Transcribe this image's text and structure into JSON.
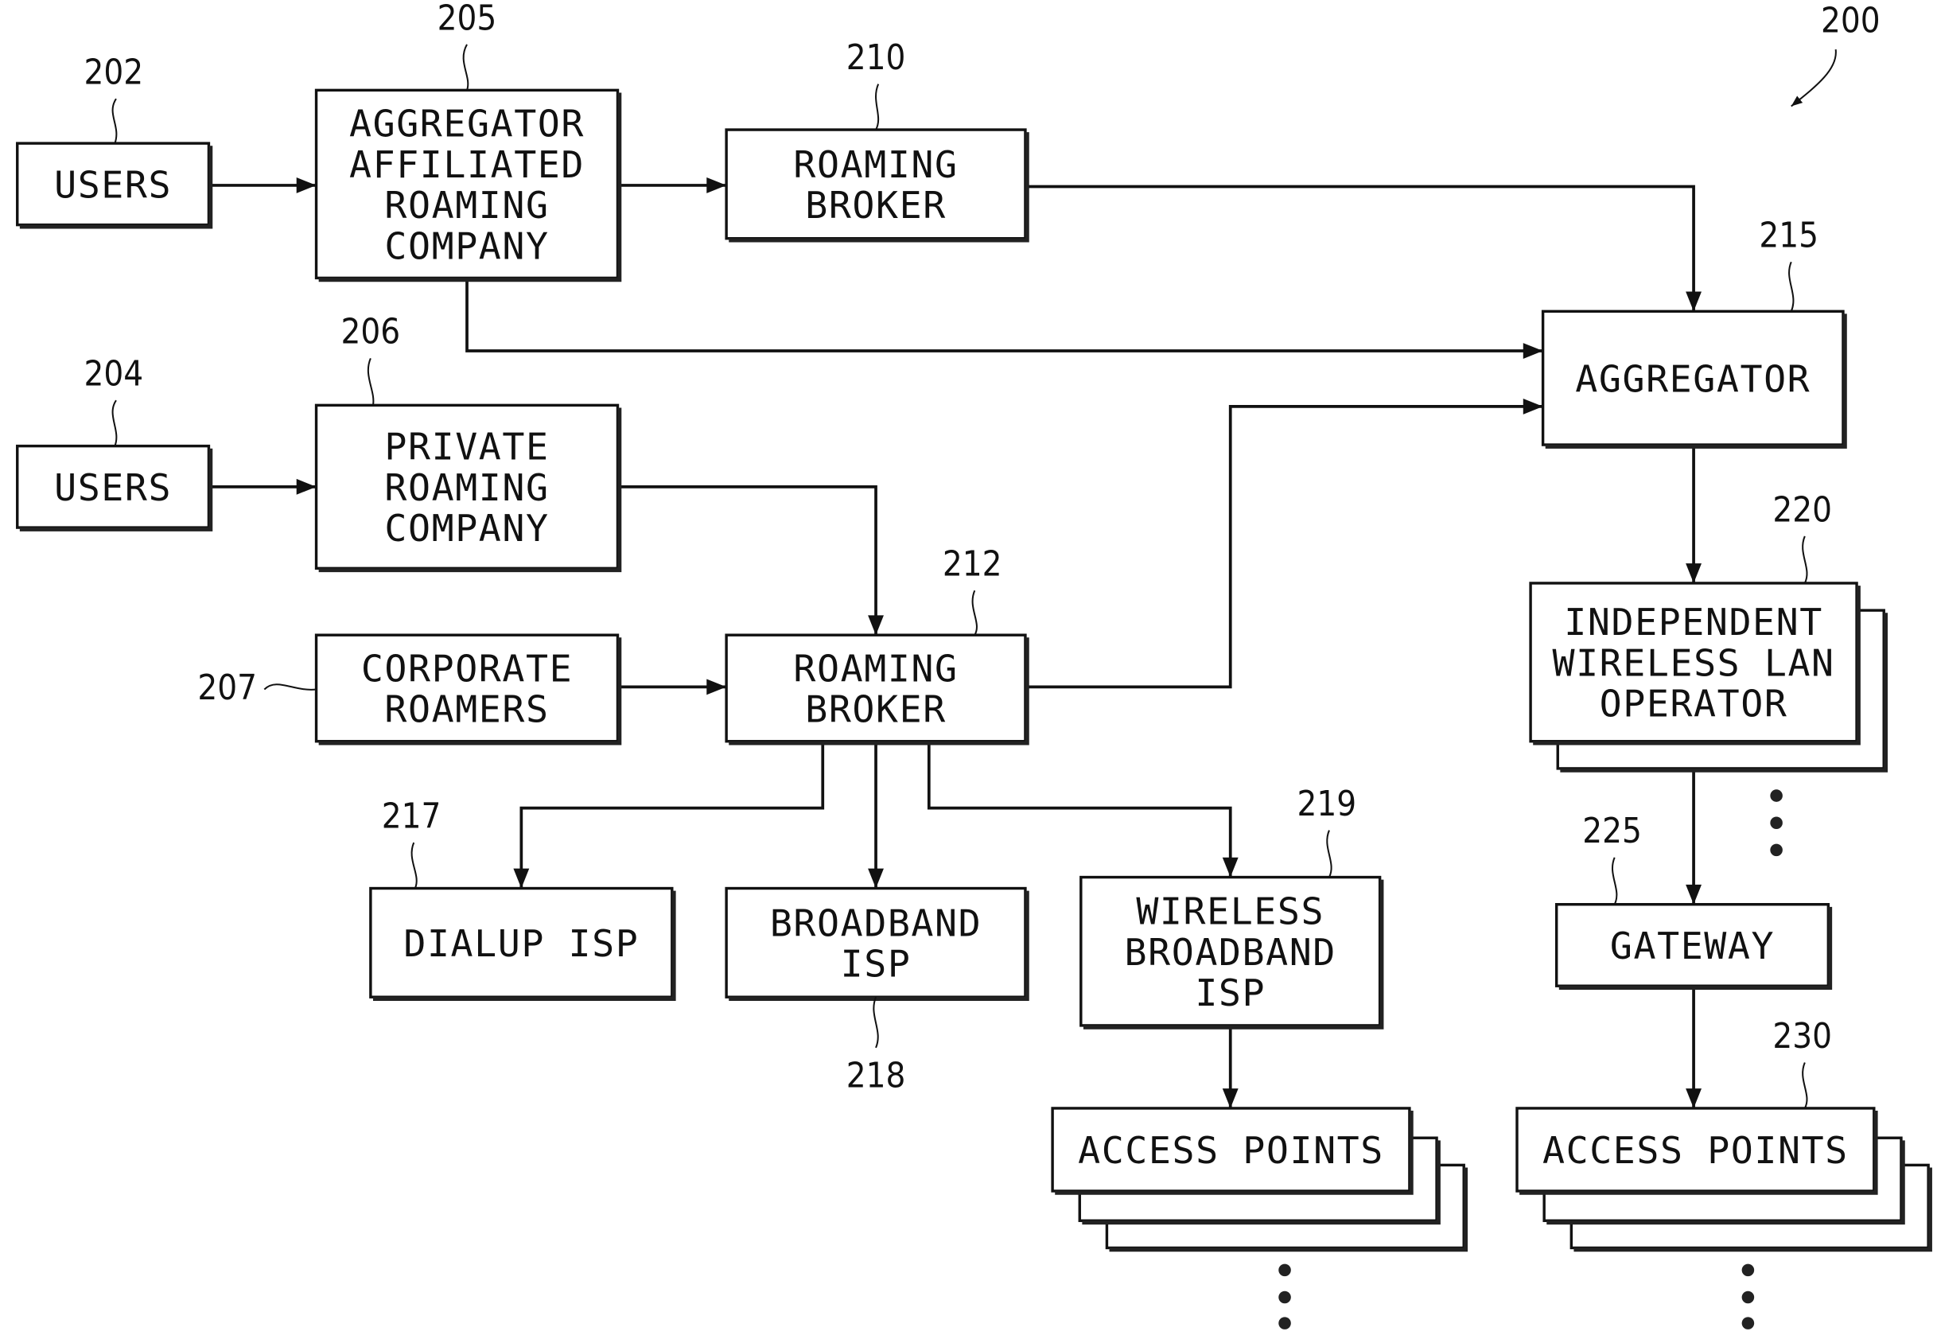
{
  "figure": {
    "title_ref": "200",
    "nodes": {
      "users_202": {
        "ref": "202",
        "lines": [
          "USERS"
        ]
      },
      "aggregator_affiliated_205": {
        "ref": "205",
        "lines": [
          "AGGREGATOR",
          "AFFILIATED",
          "ROAMING",
          "COMPANY"
        ]
      },
      "roaming_broker_210": {
        "ref": "210",
        "lines": [
          "ROAMING",
          "BROKER"
        ]
      },
      "users_204": {
        "ref": "204",
        "lines": [
          "USERS"
        ]
      },
      "private_roaming_206": {
        "ref": "206",
        "lines": [
          "PRIVATE",
          "ROAMING",
          "COMPANY"
        ]
      },
      "corporate_roamers_207": {
        "ref": "207",
        "lines": [
          "CORPORATE",
          "ROAMERS"
        ]
      },
      "roaming_broker_212": {
        "ref": "212",
        "lines": [
          "ROAMING",
          "BROKER"
        ]
      },
      "aggregator_215": {
        "ref": "215",
        "lines": [
          "AGGREGATOR"
        ]
      },
      "dialup_isp_217": {
        "ref": "217",
        "lines": [
          "DIALUP ISP"
        ]
      },
      "broadband_isp_218": {
        "ref": "218",
        "lines": [
          "BROADBAND",
          "ISP"
        ]
      },
      "wireless_broadband_isp_219": {
        "ref": "219",
        "lines": [
          "WIRELESS",
          "BROADBAND",
          "ISP"
        ]
      },
      "independent_wlan_operator_220": {
        "ref": "220",
        "lines": [
          "INDEPENDENT",
          "WIRELESS LAN",
          "OPERATOR"
        ]
      },
      "gateway_225": {
        "ref": "225",
        "lines": [
          "GATEWAY"
        ]
      },
      "access_points_230": {
        "ref": "230",
        "lines": [
          "ACCESS POINTS"
        ]
      },
      "access_points_219": {
        "ref": "",
        "lines": [
          "ACCESS POINTS"
        ]
      }
    },
    "edges": [
      [
        "users_202",
        "aggregator_affiliated_205"
      ],
      [
        "aggregator_affiliated_205",
        "roaming_broker_210"
      ],
      [
        "roaming_broker_210",
        "aggregator_215"
      ],
      [
        "aggregator_affiliated_205",
        "aggregator_215"
      ],
      [
        "users_204",
        "private_roaming_206"
      ],
      [
        "private_roaming_206",
        "roaming_broker_212"
      ],
      [
        "corporate_roamers_207",
        "roaming_broker_212"
      ],
      [
        "roaming_broker_212",
        "aggregator_215"
      ],
      [
        "roaming_broker_212",
        "dialup_isp_217"
      ],
      [
        "roaming_broker_212",
        "broadband_isp_218"
      ],
      [
        "roaming_broker_212",
        "wireless_broadband_isp_219"
      ],
      [
        "aggregator_215",
        "independent_wlan_operator_220"
      ],
      [
        "independent_wlan_operator_220",
        "gateway_225"
      ],
      [
        "gateway_225",
        "access_points_230"
      ],
      [
        "wireless_broadband_isp_219",
        "access_points_219"
      ]
    ]
  }
}
